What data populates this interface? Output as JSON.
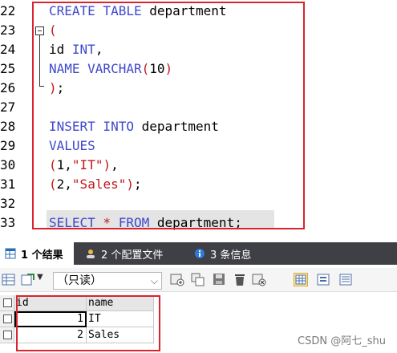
{
  "editor": {
    "line_numbers": [
      "22",
      "23",
      "24",
      "25",
      "26",
      "27",
      "28",
      "29",
      "30",
      "31",
      "32",
      "33"
    ],
    "lines": {
      "l22": {
        "kw1": "CREATE TABLE",
        "rest": " department"
      },
      "l23": {
        "text": "("
      },
      "l24": {
        "pre": "id ",
        "kw": "INT",
        "post": ","
      },
      "l25": {
        "kw": "NAME VARCHAR",
        "op1": "(",
        "num": "10",
        "op2": ")"
      },
      "l26": {
        "op": ")",
        "post": ";"
      },
      "l28": {
        "kw": "INSERT INTO",
        "rest": " department"
      },
      "l29": {
        "kw": "VALUES"
      },
      "l30": {
        "op1": "(",
        "num": "1",
        "c": ",",
        "str": "\"IT\"",
        "op2": ")",
        "post": ","
      },
      "l31": {
        "op1": "(",
        "num": "2",
        "c": ",",
        "str": "\"Sales\"",
        "op2": ")",
        "post": ";"
      },
      "l33": {
        "kw1": "SELECT",
        "star": " * ",
        "kw2": "FROM",
        "rest": " department;"
      }
    }
  },
  "tabs": [
    {
      "label": "1 个结果",
      "icon": "table-result-icon"
    },
    {
      "label": "2 个配置文件",
      "icon": "profile-icon"
    },
    {
      "label": "3 条信息",
      "icon": "info-icon"
    }
  ],
  "toolbar": {
    "mode_select": "（只读）"
  },
  "results": {
    "columns": [
      "id",
      "name"
    ],
    "rows": [
      {
        "id": "1",
        "name": "IT"
      },
      {
        "id": "2",
        "name": "Sales"
      }
    ]
  },
  "watermark": "CSDN @阿七_shu"
}
